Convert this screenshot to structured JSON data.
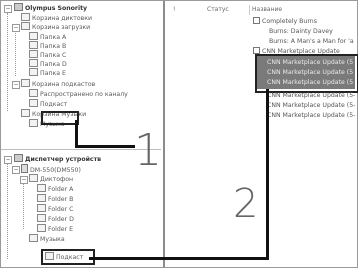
{
  "tree_top": {
    "root": "Olympus Sonority",
    "items": [
      {
        "label": "Корзина диктовки"
      },
      {
        "label": "Корзина загрузки"
      },
      {
        "label": "Папка A"
      },
      {
        "label": "Папка B"
      },
      {
        "label": "Папка C"
      },
      {
        "label": "Папка D"
      },
      {
        "label": "Папка E"
      },
      {
        "label": "Корзина подкастов"
      },
      {
        "label": "Распространено по каналу"
      },
      {
        "label": "Подкаст"
      },
      {
        "label": "Корзина Музыки"
      },
      {
        "label": "Музыка"
      }
    ]
  },
  "tree_bottom": {
    "root": "Диспетчер устройств",
    "device": "DM-550(DM550)",
    "items": [
      {
        "label": "Диктофон"
      },
      {
        "label": "Folder A"
      },
      {
        "label": "Folder B"
      },
      {
        "label": "Folder C"
      },
      {
        "label": "Folder D"
      },
      {
        "label": "Folder E"
      },
      {
        "label": "Музыка"
      },
      {
        "label": "Подкаст"
      }
    ]
  },
  "list": {
    "columns": [
      "!",
      "Статус",
      "Название"
    ],
    "rows": [
      {
        "name": "Completely Burns"
      },
      {
        "name": "Burns: Dainty Davey"
      },
      {
        "name": "Burns: A Man's a Man for 'a"
      },
      {
        "name": "CNN Marketplace Update"
      },
      {
        "name": "CNN Marketplace Update (5"
      },
      {
        "name": "CNN Marketplace Update (5"
      },
      {
        "name": "CNN Marketplace Update (5"
      },
      {
        "name": "CNN Marketplace Update (5-"
      },
      {
        "name": "CNN Marketplace Update (5-"
      },
      {
        "name": "CNN Marketplace Update (5-"
      }
    ]
  },
  "callouts": {
    "one": "1",
    "two": "2"
  },
  "colors": {
    "selection": "#7a7a7a",
    "callout": "#111111"
  }
}
